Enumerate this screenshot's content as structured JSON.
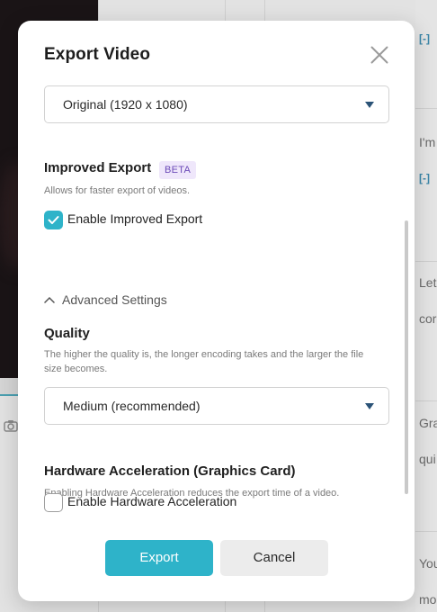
{
  "background": {
    "right_column_texts": [
      "I'm",
      "Let",
      "cor",
      "Gra",
      "qui",
      "You",
      "mo"
    ],
    "bracket_label": "[-]"
  },
  "modal": {
    "title": "Export Video",
    "resolution_select": {
      "value": "Original (1920 x 1080)"
    },
    "improved_export": {
      "title": "Improved Export",
      "badge": "BETA",
      "description": "Allows for faster export of videos.",
      "checkbox_label": "Enable Improved Export",
      "checked": true
    },
    "advanced_settings": {
      "label": "Advanced Settings",
      "expanded": true
    },
    "quality": {
      "title": "Quality",
      "description": "The higher the quality is, the longer encoding takes and the larger the file size becomes.",
      "select_value": "Medium (recommended)"
    },
    "hardware_acceleration": {
      "title": "Hardware Acceleration (Graphics Card)",
      "description": "Enabling Hardware Acceleration reduces the export time of a video.",
      "checkbox_label": "Enable Hardware Acceleration",
      "checked": false
    },
    "buttons": {
      "export": "Export",
      "cancel": "Cancel"
    }
  },
  "colors": {
    "accent": "#2eb3c9",
    "badge_bg": "#efe7fb",
    "badge_text": "#6c4bb8",
    "caret": "#2b5377"
  },
  "icons": {
    "close": "close-icon",
    "caret": "chevron-down-icon",
    "check": "check-icon",
    "advanced": "chevron-up-icon",
    "camera": "camera-icon"
  }
}
